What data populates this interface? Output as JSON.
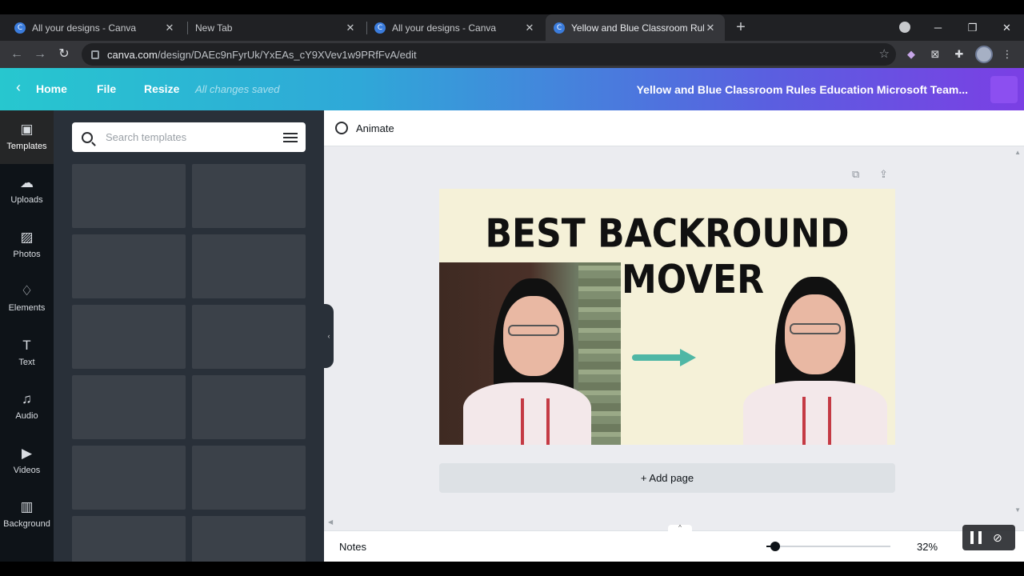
{
  "browser": {
    "tabs": [
      {
        "title": "All your designs - Canva",
        "favicon": "C",
        "active": false
      },
      {
        "title": "New Tab",
        "favicon": "",
        "active": false
      },
      {
        "title": "All your designs - Canva",
        "favicon": "C",
        "active": false
      },
      {
        "title": "Yellow and Blue Classroom Rules",
        "favicon": "C",
        "active": true
      }
    ],
    "new_tab_symbol": "+",
    "close_symbol": "✕",
    "window_controls": {
      "minimize": "─",
      "restore": "❐",
      "close": "✕"
    },
    "nav": {
      "back": "←",
      "forward": "→",
      "reload": "↻"
    },
    "url": {
      "host": "canva.com",
      "path": "/design/DAEc9nFyrUk/YxEAs_cY9XVev1w9PRfFvA/edit"
    },
    "star_symbol": "☆"
  },
  "header": {
    "back_symbol": "‹",
    "home": "Home",
    "file": "File",
    "resize": "Resize",
    "saved_status": "All changes saved",
    "doc_title": "Yellow and Blue Classroom Rules Education Microsoft Team...",
    "colors": {
      "gradient_start": "#27c7cf",
      "gradient_end": "#7b3fe4"
    }
  },
  "rail": {
    "items": [
      {
        "label": "Templates",
        "icon": "templates-icon",
        "glyph": "▣"
      },
      {
        "label": "Uploads",
        "icon": "upload-cloud-icon",
        "glyph": "☁"
      },
      {
        "label": "Photos",
        "icon": "photo-icon",
        "glyph": "▨"
      },
      {
        "label": "Elements",
        "icon": "shapes-icon",
        "glyph": "♢"
      },
      {
        "label": "Text",
        "icon": "text-icon",
        "glyph": "T"
      },
      {
        "label": "Audio",
        "icon": "music-note-icon",
        "glyph": "♫"
      },
      {
        "label": "Videos",
        "icon": "video-icon",
        "glyph": "▶"
      },
      {
        "label": "Background",
        "icon": "background-pattern-icon",
        "glyph": "▥"
      }
    ]
  },
  "panel": {
    "search_placeholder": "Search templates",
    "tiles": 12
  },
  "editor": {
    "animate": "Animate",
    "design": {
      "heading": "BEST BACKROUND REMOVER",
      "background_color": "#f5f1d8",
      "arrow_color": "#4fb7a5"
    },
    "add_page": "+ Add page"
  },
  "footer": {
    "notes": "Notes",
    "zoom": "32%",
    "notes_tab_symbol": "^"
  }
}
